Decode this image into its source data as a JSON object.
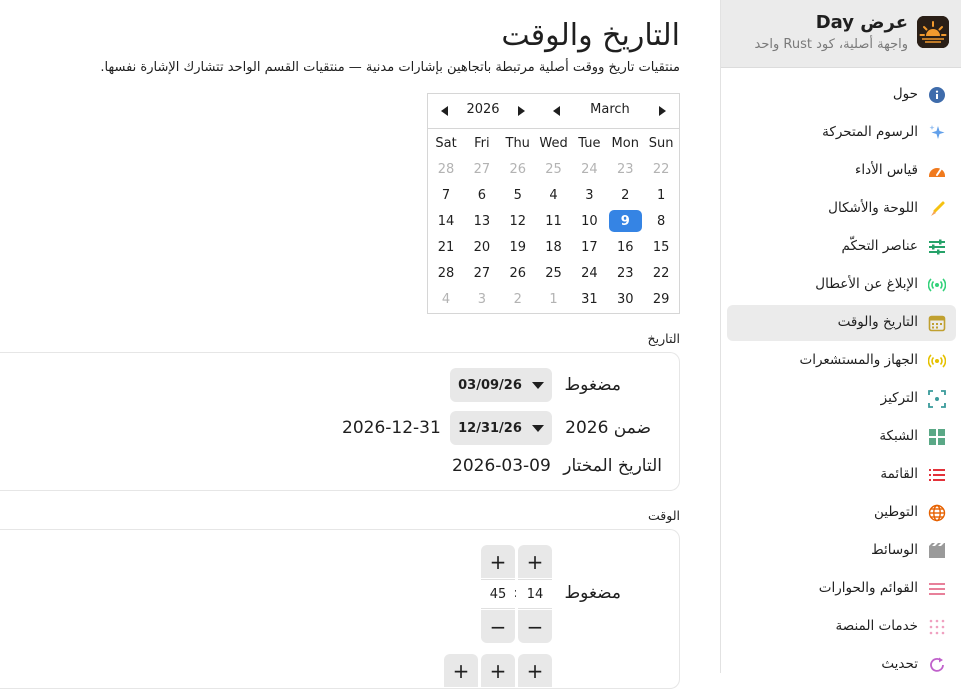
{
  "sidebar": {
    "app_title": "عرض Day",
    "app_subtitle": "واجهة أصلية، كود Rust واحد",
    "items": [
      {
        "label": "حول",
        "icon": "info-icon",
        "color": "#3f6cab"
      },
      {
        "label": "الرسوم المتحركة",
        "icon": "sparkles-icon",
        "color": "#62a0ea"
      },
      {
        "label": "قياس الأداء",
        "icon": "speedometer-icon",
        "color": "#f07a1e"
      },
      {
        "label": "اللوحة والأشكال",
        "icon": "brush-icon",
        "color": "#f5c211"
      },
      {
        "label": "عناصر التحكّم",
        "icon": "sliders-icon",
        "color": "#26a269"
      },
      {
        "label": "الإبلاغ عن الأعطال",
        "icon": "broadcast-icon",
        "color": "#33d17a"
      },
      {
        "label": "التاريخ والوقت",
        "icon": "calendar-icon",
        "color": "#c0a030"
      },
      {
        "label": "الجهاز والمستشعرات",
        "icon": "sensor-icon",
        "color": "#e5c100"
      },
      {
        "label": "التركيز",
        "icon": "focus-icon",
        "color": "#3a9b9b"
      },
      {
        "label": "الشبكة",
        "icon": "grid-icon",
        "color": "#5aa886"
      },
      {
        "label": "القائمة",
        "icon": "list-icon",
        "color": "#e01b24"
      },
      {
        "label": "التوطين",
        "icon": "globe-icon",
        "color": "#e66100"
      },
      {
        "label": "الوسائط",
        "icon": "film-icon",
        "color": "#9a9a9a"
      },
      {
        "label": "القوائم والحوارات",
        "icon": "menu-icon",
        "color": "#e36080"
      },
      {
        "label": "خدمات المنصة",
        "icon": "dots-grid-icon",
        "color": "#f0a0c0"
      },
      {
        "label": "تحديث",
        "icon": "refresh-icon",
        "color": "#c061cb"
      }
    ],
    "active_index": 6
  },
  "main": {
    "title": "التاريخ والوقت",
    "subtitle": "منتقيات تاريخ ووقت أصلية مرتبطة باتجاهين بإشارات مدنية — منتقيات القسم الواحد تتشارك الإشارة نفسها."
  },
  "calendar": {
    "month": "March",
    "year": "2026",
    "weekdays": [
      "Sun",
      "Mon",
      "Tue",
      "Wed",
      "Thu",
      "Fri",
      "Sat"
    ],
    "weeks": [
      [
        {
          "d": "22",
          "m": true
        },
        {
          "d": "23",
          "m": true
        },
        {
          "d": "24",
          "m": true
        },
        {
          "d": "25",
          "m": true
        },
        {
          "d": "26",
          "m": true
        },
        {
          "d": "27",
          "m": true
        },
        {
          "d": "28",
          "m": true
        }
      ],
      [
        {
          "d": "1"
        },
        {
          "d": "2"
        },
        {
          "d": "3"
        },
        {
          "d": "4"
        },
        {
          "d": "5"
        },
        {
          "d": "6"
        },
        {
          "d": "7"
        }
      ],
      [
        {
          "d": "8"
        },
        {
          "d": "9",
          "s": true
        },
        {
          "d": "10"
        },
        {
          "d": "11"
        },
        {
          "d": "12"
        },
        {
          "d": "13"
        },
        {
          "d": "14"
        }
      ],
      [
        {
          "d": "15"
        },
        {
          "d": "16"
        },
        {
          "d": "17"
        },
        {
          "d": "18"
        },
        {
          "d": "19"
        },
        {
          "d": "20"
        },
        {
          "d": "21"
        }
      ],
      [
        {
          "d": "22"
        },
        {
          "d": "23"
        },
        {
          "d": "24"
        },
        {
          "d": "25"
        },
        {
          "d": "26"
        },
        {
          "d": "27"
        },
        {
          "d": "28"
        }
      ],
      [
        {
          "d": "29"
        },
        {
          "d": "30"
        },
        {
          "d": "31"
        },
        {
          "d": "1",
          "m": true
        },
        {
          "d": "2",
          "m": true
        },
        {
          "d": "3",
          "m": true
        },
        {
          "d": "4",
          "m": true
        }
      ]
    ],
    "accent": "#3584e4"
  },
  "date_section": {
    "label": "التاريخ",
    "compact_label": "مضغوط",
    "compact_value": "03/09/26",
    "range_label": "ضمن 2026",
    "range_value": "12/31/26",
    "range_max": "2026-12-31",
    "selected_label": "التاريخ المختار",
    "selected_value": "2026-03-09"
  },
  "time_section": {
    "label": "الوقت",
    "compact_label": "مضغوط",
    "hour": "14",
    "minute": "45",
    "separator": ":",
    "plus": "+",
    "minus": "−"
  }
}
